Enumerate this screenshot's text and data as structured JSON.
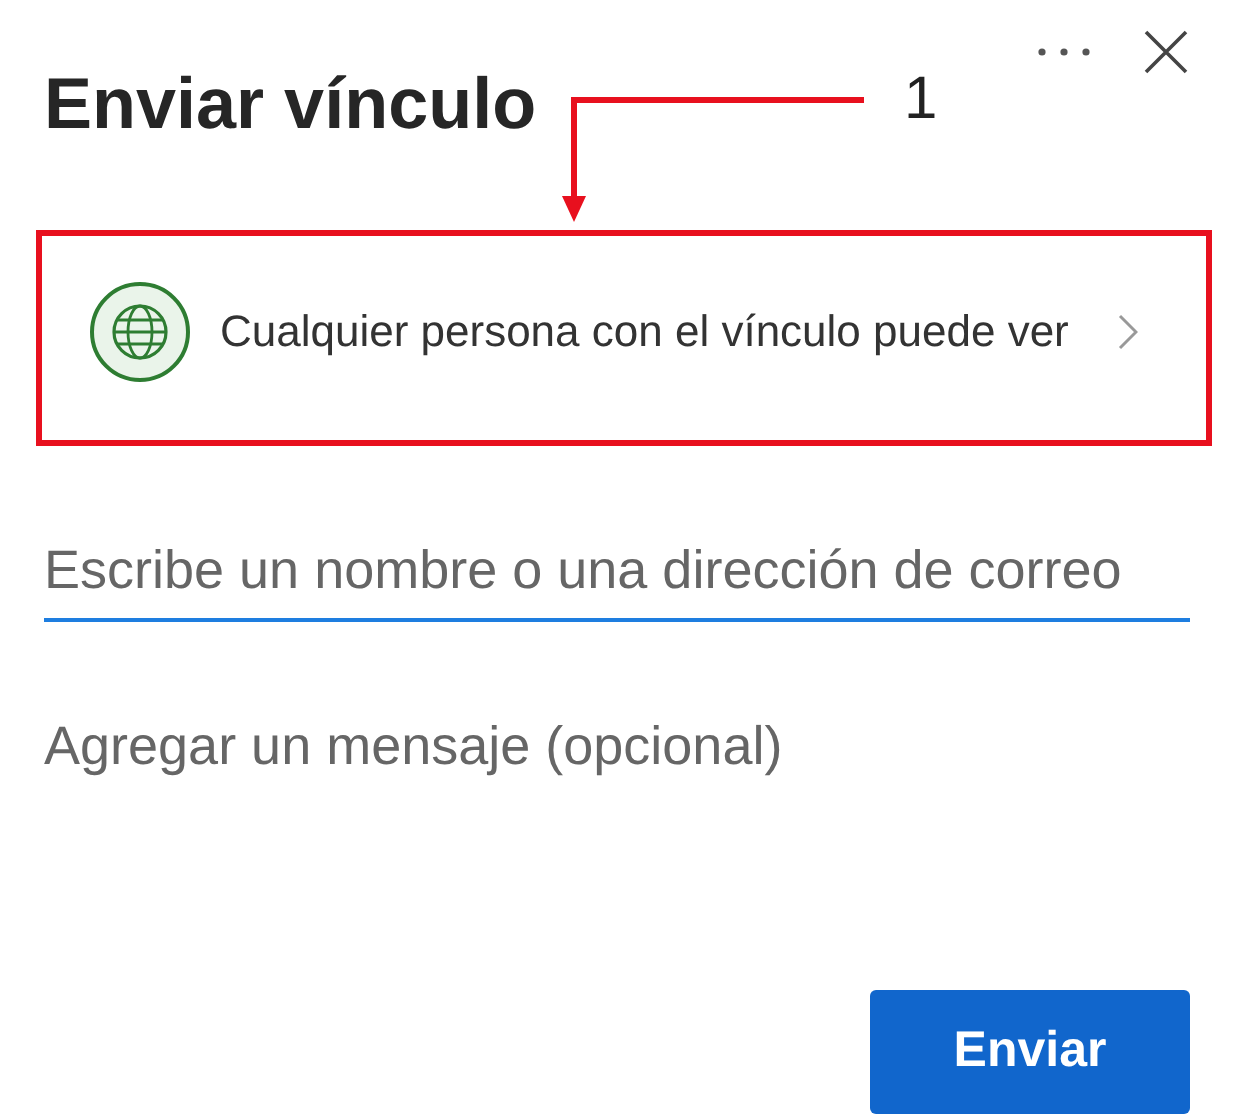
{
  "dialog": {
    "title": "Enviar vínculo"
  },
  "link_setting": {
    "label": "Cualquier persona con el vínculo puede ver"
  },
  "recipient_field": {
    "placeholder": "Escribe un nombre o una dirección de correo"
  },
  "message_field": {
    "placeholder": "Agregar un mensaje (opcional)"
  },
  "buttons": [
    "Enviar"
  ],
  "annotation": {
    "label": "1"
  }
}
